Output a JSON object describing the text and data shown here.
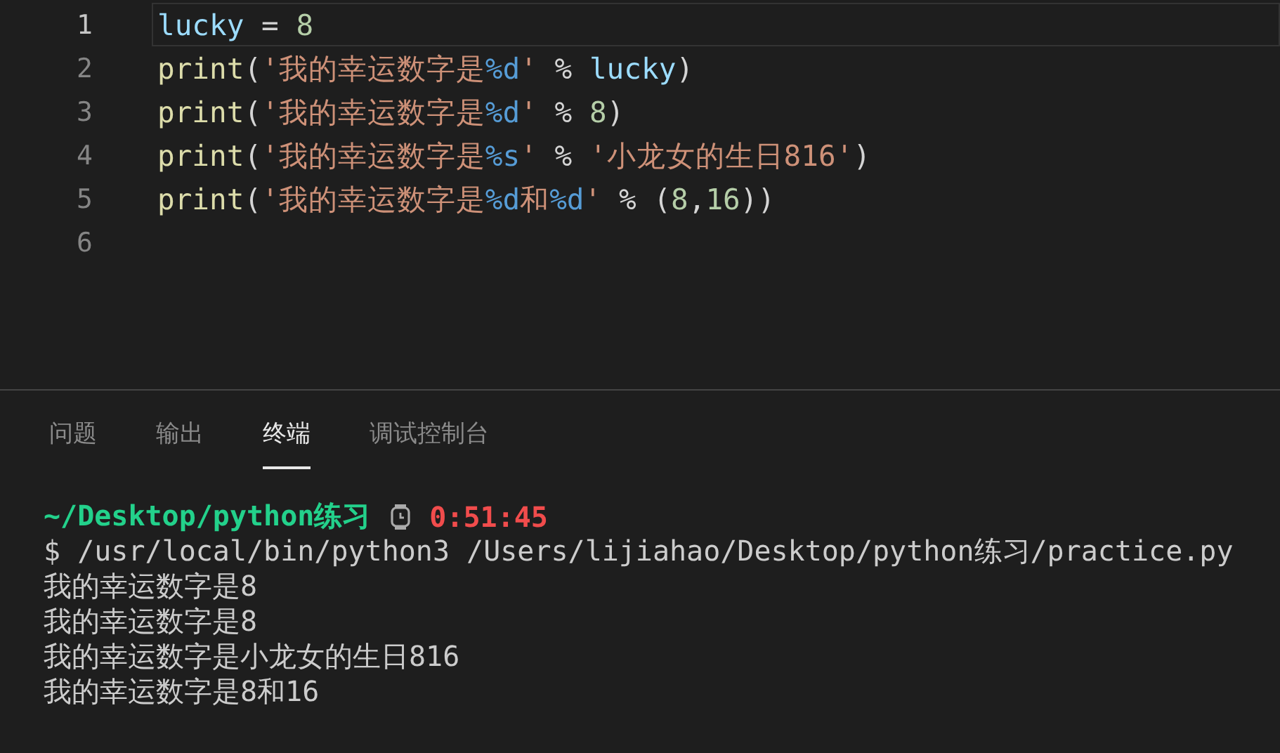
{
  "editor": {
    "lines": [
      {
        "number": "1",
        "current": true,
        "tokens": [
          {
            "kind": "name",
            "text": "lucky"
          },
          {
            "kind": "operator",
            "text": " = "
          },
          {
            "kind": "number",
            "text": "8"
          }
        ]
      },
      {
        "number": "2",
        "current": false,
        "tokens": [
          {
            "kind": "func",
            "text": "print"
          },
          {
            "kind": "paren",
            "text": "("
          },
          {
            "kind": "string",
            "text": "'我的幸运数字是"
          },
          {
            "kind": "format",
            "text": "%d"
          },
          {
            "kind": "string",
            "text": "'"
          },
          {
            "kind": "operator",
            "text": " % "
          },
          {
            "kind": "name",
            "text": "lucky"
          },
          {
            "kind": "paren",
            "text": ")"
          }
        ]
      },
      {
        "number": "3",
        "current": false,
        "tokens": [
          {
            "kind": "func",
            "text": "print"
          },
          {
            "kind": "paren",
            "text": "("
          },
          {
            "kind": "string",
            "text": "'我的幸运数字是"
          },
          {
            "kind": "format",
            "text": "%d"
          },
          {
            "kind": "string",
            "text": "'"
          },
          {
            "kind": "operator",
            "text": " % "
          },
          {
            "kind": "number",
            "text": "8"
          },
          {
            "kind": "paren",
            "text": ")"
          }
        ]
      },
      {
        "number": "4",
        "current": false,
        "tokens": [
          {
            "kind": "func",
            "text": "print"
          },
          {
            "kind": "paren",
            "text": "("
          },
          {
            "kind": "string",
            "text": "'我的幸运数字是"
          },
          {
            "kind": "format",
            "text": "%s"
          },
          {
            "kind": "string",
            "text": "'"
          },
          {
            "kind": "operator",
            "text": " % "
          },
          {
            "kind": "string",
            "text": "'小龙女的生日816'"
          },
          {
            "kind": "paren",
            "text": ")"
          }
        ]
      },
      {
        "number": "5",
        "current": false,
        "tokens": [
          {
            "kind": "func",
            "text": "print"
          },
          {
            "kind": "paren",
            "text": "("
          },
          {
            "kind": "string",
            "text": "'我的幸运数字是"
          },
          {
            "kind": "format",
            "text": "%d"
          },
          {
            "kind": "string",
            "text": "和"
          },
          {
            "kind": "format",
            "text": "%d"
          },
          {
            "kind": "string",
            "text": "'"
          },
          {
            "kind": "operator",
            "text": " % "
          },
          {
            "kind": "paren",
            "text": "("
          },
          {
            "kind": "number",
            "text": "8"
          },
          {
            "kind": "paren",
            "text": ","
          },
          {
            "kind": "number",
            "text": "16"
          },
          {
            "kind": "paren",
            "text": "))"
          }
        ]
      },
      {
        "number": "6",
        "current": false
      }
    ]
  },
  "panel": {
    "tabs": [
      {
        "label": "问题",
        "selected": false
      },
      {
        "label": "输出",
        "selected": false
      },
      {
        "label": "终端",
        "selected": true
      },
      {
        "label": "调试控制台",
        "selected": false
      }
    ]
  },
  "terminal": {
    "prompt": {
      "path": "~/Desktop/python练习",
      "time": "0:51:45"
    },
    "lines": [
      "$ /usr/local/bin/python3 /Users/lijiahao/Desktop/python练习/practice.py",
      "我的幸运数字是8",
      "我的幸运数字是8",
      "我的幸运数字是小龙女的生日816",
      "我的幸运数字是8和16"
    ]
  }
}
